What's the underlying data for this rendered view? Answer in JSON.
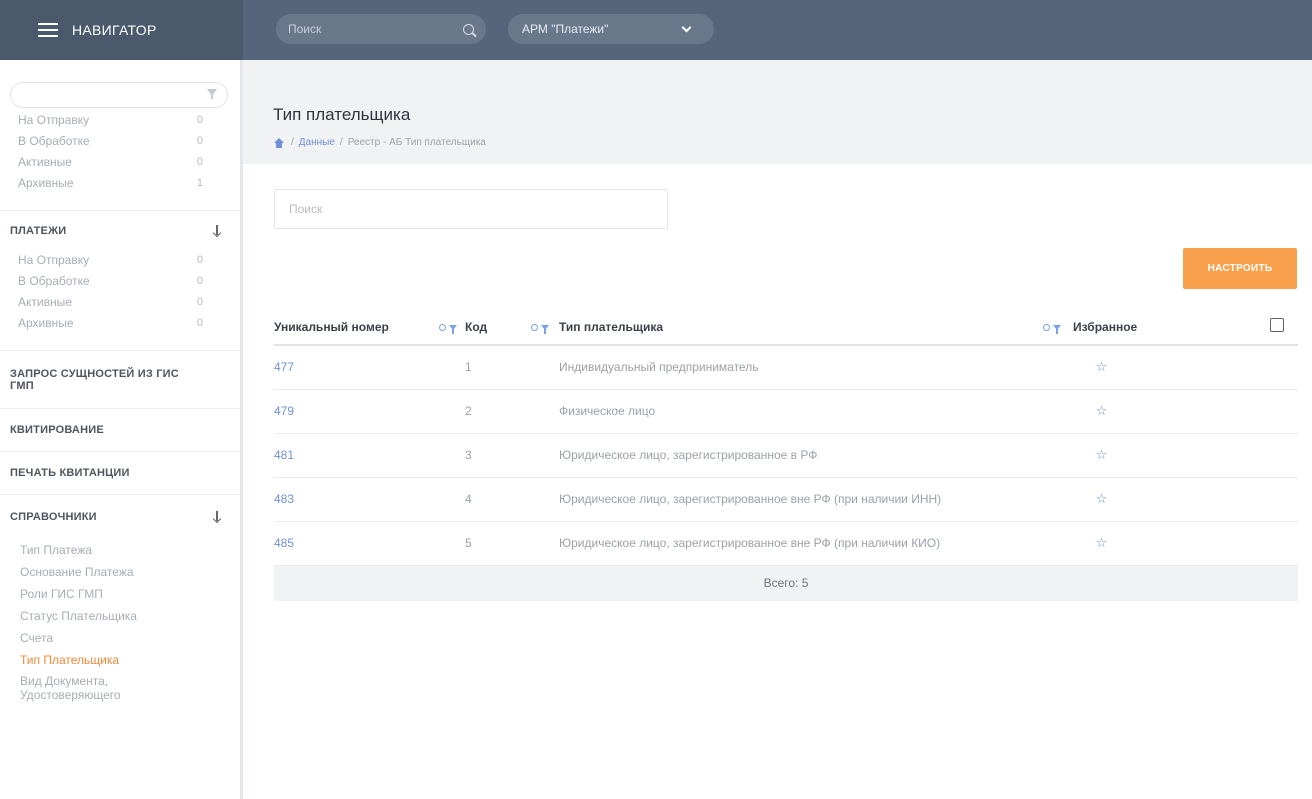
{
  "topbar": {
    "nav_title": "НАВИГАТОР",
    "search_placeholder": "Поиск",
    "arm_select": "АРМ \"Платежи\""
  },
  "sidebar": {
    "filter_placeholder": "",
    "status_group_1": [
      {
        "label": "На Отправку",
        "count": "0"
      },
      {
        "label": "В Обработке",
        "count": "0"
      },
      {
        "label": "Активные",
        "count": "0"
      },
      {
        "label": "Архивные",
        "count": "1"
      }
    ],
    "section_payments": "ПЛАТЕЖИ",
    "status_group_2": [
      {
        "label": "На Отправку",
        "count": "0"
      },
      {
        "label": "В Обработке",
        "count": "0"
      },
      {
        "label": "Активные",
        "count": "0"
      },
      {
        "label": "Архивные",
        "count": "0"
      }
    ],
    "section_request": "ЗАПРОС СУЩНОСТЕЙ ИЗ ГИС ГМП",
    "section_kvit": "КВИТИРОВАНИЕ",
    "section_print": "ПЕЧАТЬ КВИТАНЦИИ",
    "section_refs": "СПРАВОЧНИКИ",
    "refs": [
      "Тип Платежа",
      "Основание Платежа",
      "Роли ГИС ГМП",
      "Статус Плательщика",
      "Счета",
      "Тип Плательщика",
      "Вид Документа, Удостоверяющего"
    ],
    "active_ref_index": 5
  },
  "page": {
    "title": "Тип плательщика",
    "breadcrumb_link": "Данные",
    "breadcrumb_rest": "Реестр - АБ Тип плательщика",
    "search_placeholder": "Поиск",
    "setup_button": "НАСТРОИТЬ"
  },
  "table": {
    "headers": {
      "uid": "Уникальный номер",
      "code": "Код",
      "type": "Тип плательщика",
      "fav": "Избранное"
    },
    "rows": [
      {
        "uid": "477",
        "code": "1",
        "type": "Индивидуальный предприниматель"
      },
      {
        "uid": "479",
        "code": "2",
        "type": "Физическое лицо"
      },
      {
        "uid": "481",
        "code": "3",
        "type": "Юридическое лицо, зарегистрированное в РФ"
      },
      {
        "uid": "483",
        "code": "4",
        "type": "Юридическое лицо, зарегистрированное вне РФ (при наличии ИНН)"
      },
      {
        "uid": "485",
        "code": "5",
        "type": "Юридическое лицо, зарегистрированное вне РФ (при наличии КИО)"
      }
    ],
    "total": "Всего: 5"
  },
  "colors": {
    "accent": "#f9a04d",
    "link": "#6f8fd8",
    "topbar": "#56657b",
    "active_nav": "#f08a3a"
  }
}
